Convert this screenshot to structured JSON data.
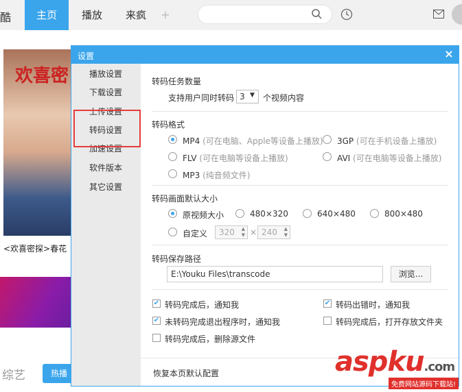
{
  "app": {
    "logo_char": "酷"
  },
  "nav": {
    "home": "主页",
    "play": "播放",
    "laifeng": "来疯",
    "add": "+"
  },
  "search": {
    "placeholder": ""
  },
  "background": {
    "poster_text": "欢喜密",
    "poster_caption": "<欢喜密探>春花",
    "section_title": "综艺",
    "hot_button": "热播"
  },
  "dialog": {
    "title": "设置",
    "close": "×",
    "sidebar": {
      "items": [
        "播放设置",
        "下载设置",
        "上传设置",
        "转码设置",
        "加速设置",
        "软件版本",
        "其它设置"
      ],
      "selected": "转码设置"
    },
    "task_count": {
      "heading": "转码任务数量",
      "prefix": "支持用户同时转码",
      "value": "3",
      "suffix": "个视频内容"
    },
    "format": {
      "heading": "转码格式",
      "options": [
        {
          "label": "MP4",
          "note": "(可在电脑、Apple等设备上播放)",
          "checked": true
        },
        {
          "label": "3GP",
          "note": "(可在手机设备上播放)",
          "checked": false
        },
        {
          "label": "FLV",
          "note": "(可在电脑等设备上播放)",
          "checked": false
        },
        {
          "label": "AVI",
          "note": "(可在电脑等设备上播放)",
          "checked": false
        },
        {
          "label": "MP3",
          "note": "(纯音频文件)",
          "checked": false
        }
      ]
    },
    "size": {
      "heading": "转码画面默认大小",
      "options": [
        {
          "label": "原视频大小",
          "checked": true
        },
        {
          "label": "480×320",
          "checked": false
        },
        {
          "label": "640×480",
          "checked": false
        },
        {
          "label": "800×480",
          "checked": false
        },
        {
          "label": "自定义",
          "checked": false
        }
      ],
      "custom_width": "320",
      "times": "×",
      "custom_height": "240"
    },
    "path": {
      "heading": "转码保存路径",
      "value": "E:\\Youku Files\\transcode",
      "browse": "浏览..."
    },
    "checkboxes": [
      {
        "label": "转码完成后，通知我",
        "checked": true
      },
      {
        "label": "转码出错时，通知我",
        "checked": true
      },
      {
        "label": "未转码完成退出程序时，通知我",
        "checked": true
      },
      {
        "label": "转码完成后，打开存放文件夹",
        "checked": false
      },
      {
        "label": "转码完成后，删除源文件",
        "checked": false
      }
    ],
    "footer": {
      "restore": "恢复本页默认配置"
    }
  },
  "watermark": {
    "text": "aspku",
    "suffix": ".com",
    "sub": "免费网站源码下载站!"
  },
  "colors": {
    "accent": "#3ba5ec",
    "highlight": "#e53b3b",
    "watermark": "#e0302c"
  }
}
